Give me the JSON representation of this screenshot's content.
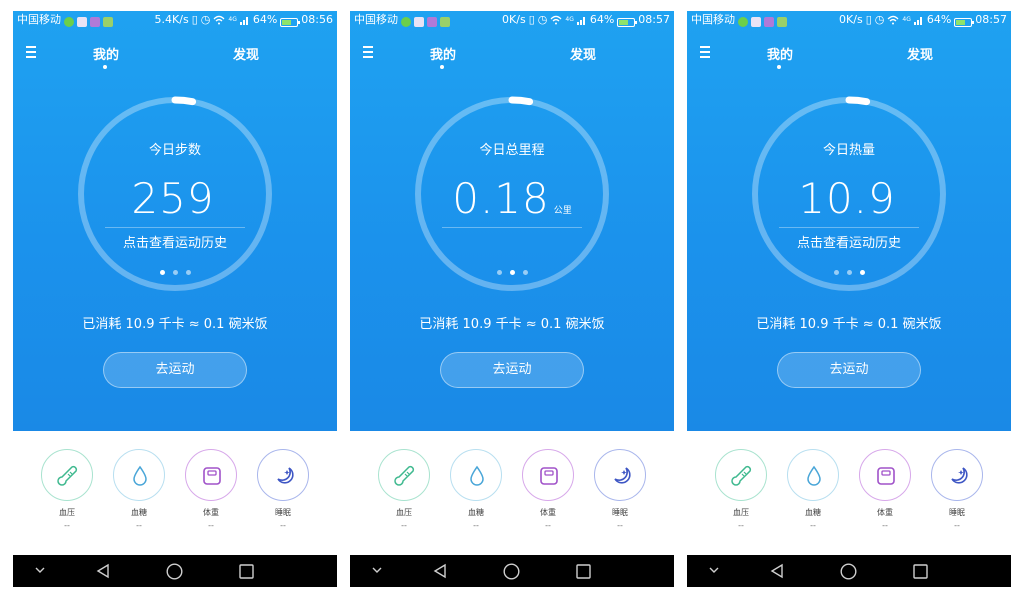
{
  "screens": [
    {
      "status": {
        "carrier": "中国移动",
        "speed": "5.4K/s",
        "network": "4G",
        "battery": "64%",
        "time": "08:56"
      },
      "tabs": {
        "mine": "我的",
        "discover": "发现"
      },
      "ring": {
        "label": "今日步数",
        "value": "259",
        "unit": "",
        "link": "点击查看运动历史",
        "progress": 0.03,
        "page_index": 0
      },
      "consumed": "已消耗 10.9 千卡 ≈ 0.1 碗米饭",
      "go_button": "去运动",
      "shortcuts": [
        {
          "label": "血压",
          "value": "--",
          "icon": "thermometer-icon",
          "color": "#a9e3cf"
        },
        {
          "label": "血糖",
          "value": "--",
          "icon": "drop-icon",
          "color": "#b8dff0"
        },
        {
          "label": "体重",
          "value": "--",
          "icon": "scale-icon",
          "color": "#d7a8ea"
        },
        {
          "label": "睡眠",
          "value": "--",
          "icon": "moon-icon",
          "color": "#a9b6ec"
        }
      ]
    },
    {
      "status": {
        "carrier": "中国移动",
        "speed": "0K/s",
        "network": "4G",
        "battery": "64%",
        "time": "08:57"
      },
      "tabs": {
        "mine": "我的",
        "discover": "发现"
      },
      "ring": {
        "label": "今日总里程",
        "value": "0.18",
        "unit": "公里",
        "link": "",
        "progress": 0.03,
        "page_index": 1
      },
      "consumed": "已消耗 10.9 千卡 ≈ 0.1 碗米饭",
      "go_button": "去运动",
      "shortcuts": [
        {
          "label": "血压",
          "value": "--",
          "icon": "thermometer-icon",
          "color": "#a9e3cf"
        },
        {
          "label": "血糖",
          "value": "--",
          "icon": "drop-icon",
          "color": "#b8dff0"
        },
        {
          "label": "体重",
          "value": "--",
          "icon": "scale-icon",
          "color": "#d7a8ea"
        },
        {
          "label": "睡眠",
          "value": "--",
          "icon": "moon-icon",
          "color": "#a9b6ec"
        }
      ]
    },
    {
      "status": {
        "carrier": "中国移动",
        "speed": "0K/s",
        "network": "4G",
        "battery": "64%",
        "time": "08:57"
      },
      "tabs": {
        "mine": "我的",
        "discover": "发现"
      },
      "ring": {
        "label": "今日热量",
        "value": "10.9",
        "unit": "",
        "link": "点击查看运动历史",
        "progress": 0.03,
        "page_index": 2
      },
      "consumed": "已消耗 10.9 千卡 ≈ 0.1 碗米饭",
      "go_button": "去运动",
      "shortcuts": [
        {
          "label": "血压",
          "value": "--",
          "icon": "thermometer-icon",
          "color": "#a9e3cf"
        },
        {
          "label": "血糖",
          "value": "--",
          "icon": "drop-icon",
          "color": "#b8dff0"
        },
        {
          "label": "体重",
          "value": "--",
          "icon": "scale-icon",
          "color": "#d7a8ea"
        },
        {
          "label": "睡眠",
          "value": "--",
          "icon": "moon-icon",
          "color": "#a9b6ec"
        }
      ]
    }
  ],
  "theme": {
    "accent": "#1b92ec",
    "nav_bar": "#000000"
  }
}
